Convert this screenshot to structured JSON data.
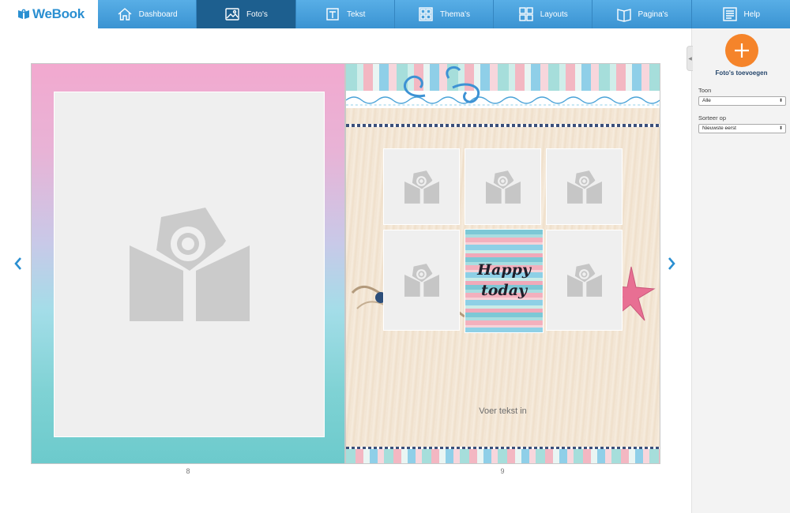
{
  "brand": {
    "name": "WeBook"
  },
  "nav": [
    {
      "label": "Dashboard",
      "icon": "home-icon"
    },
    {
      "label": "Foto's",
      "icon": "photo-icon",
      "active": true
    },
    {
      "label": "Tekst",
      "icon": "text-icon"
    },
    {
      "label": "Thema's",
      "icon": "themes-icon"
    },
    {
      "label": "Layouts",
      "icon": "layouts-icon"
    },
    {
      "label": "Pagina's",
      "icon": "pages-icon"
    },
    {
      "label": "Help",
      "icon": "help-icon"
    }
  ],
  "spread": {
    "left_page": {
      "number": "8"
    },
    "right_page": {
      "number": "9",
      "sticker_text": "Happy today",
      "text_placeholder": "Voer tekst in"
    }
  },
  "sidebar": {
    "add_label": "Foto's toevoegen",
    "show_label": "Toon",
    "show_value": "Alle",
    "sort_label": "Sorteer op",
    "sort_value": "Nieuwste eerst"
  },
  "colors": {
    "nav_blue": "#3a93d2",
    "nav_active": "#1d5f8f",
    "accent_orange": "#f5842a",
    "brand_blue": "#2a8fd1"
  }
}
